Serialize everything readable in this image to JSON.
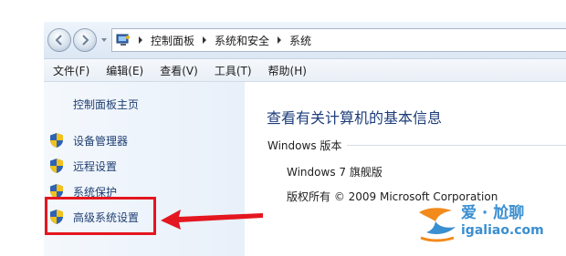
{
  "breadcrumb": {
    "items": [
      "控制面板",
      "系统和安全",
      "系统"
    ]
  },
  "menubar": {
    "items": [
      "文件(F)",
      "编辑(E)",
      "查看(V)",
      "工具(T)",
      "帮助(H)"
    ]
  },
  "sidebar": {
    "home": "控制面板主页",
    "tasks": [
      {
        "label": "设备管理器",
        "icon": "uac-shield-icon"
      },
      {
        "label": "远程设置",
        "icon": "uac-shield-icon"
      },
      {
        "label": "系统保护",
        "icon": "uac-shield-icon"
      },
      {
        "label": "高级系统设置",
        "icon": "uac-shield-icon"
      }
    ]
  },
  "main": {
    "heading": "查看有关计算机的基本信息",
    "section_label": "Windows 版本",
    "edition": "Windows 7 旗舰版",
    "copyright": "版权所有 © 2009 Microsoft Corporation"
  },
  "watermark": {
    "brand": "爱 · 尬聊",
    "url": "igaliao.com"
  },
  "colors": {
    "highlight": "#e4161f",
    "link": "#1f3f72",
    "heading": "#1e3d7b",
    "watermark": "#3a8fd0"
  }
}
